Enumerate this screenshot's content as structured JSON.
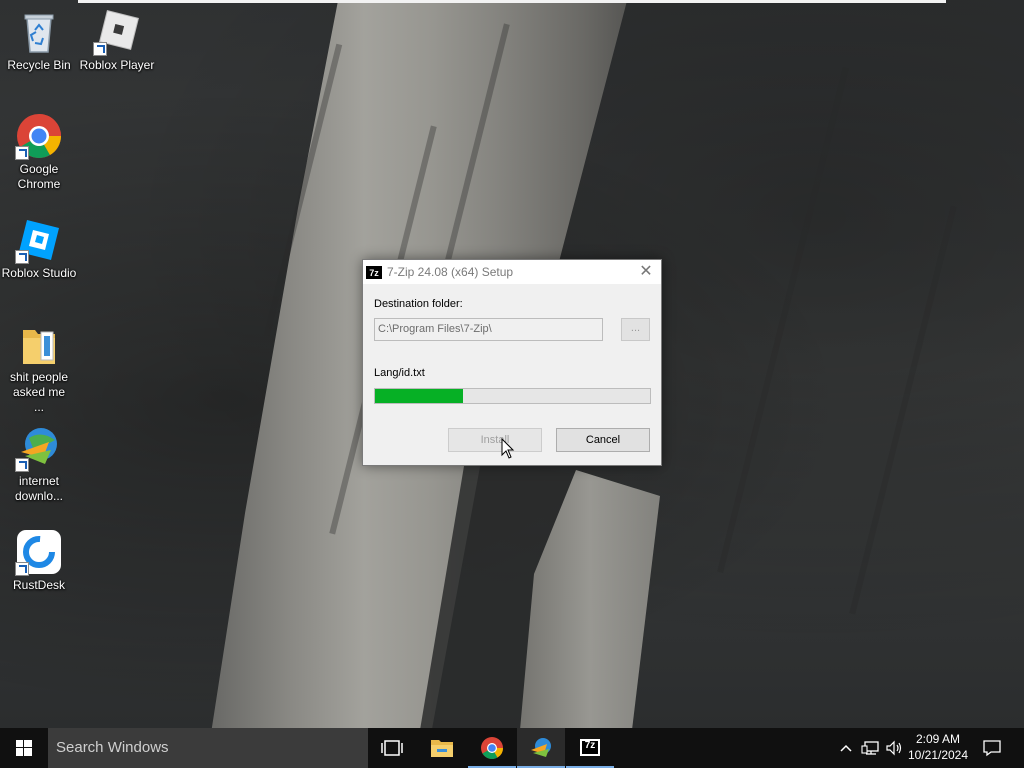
{
  "desktop": {
    "icons": [
      {
        "label": "Recycle Bin"
      },
      {
        "label": "Roblox Player"
      },
      {
        "label": "Google Chrome"
      },
      {
        "label": "Roblox Studio"
      },
      {
        "label": "shit people asked me ..."
      },
      {
        "label": "internet downlo..."
      },
      {
        "label": "RustDesk"
      }
    ]
  },
  "dialog": {
    "title": "7-Zip 24.08 (x64) Setup",
    "logo_text": "7z",
    "close_glyph": "✕",
    "destination_label": "Destination folder:",
    "destination_value": "C:\\Program Files\\7-Zip\\",
    "browse_label": "...",
    "current_file": "Lang/id.txt",
    "progress_fraction": 0.32,
    "install_label": "Install",
    "cancel_label": "Cancel",
    "install_enabled": false
  },
  "taskbar": {
    "search_placeholder": "Search Windows",
    "apps": [
      {
        "name": "task-view"
      },
      {
        "name": "file-explorer"
      },
      {
        "name": "google-chrome"
      },
      {
        "name": "internet-download-manager",
        "active": true
      },
      {
        "name": "7-zip"
      }
    ],
    "clock_time": "2:09 AM",
    "clock_date": "10/21/2024",
    "seven_zip_label": "7z"
  },
  "colors": {
    "progress_green": "#06b025",
    "taskbar_bg": "#101010",
    "search_bg": "#3b3b3b"
  }
}
